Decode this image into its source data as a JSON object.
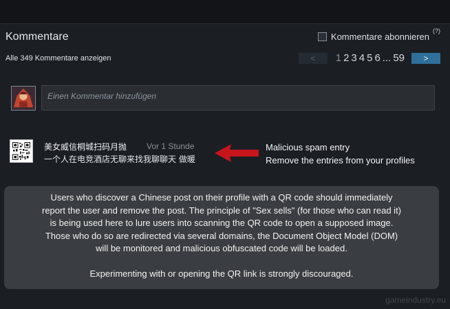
{
  "comments": {
    "title": "Kommentare",
    "subscribe_label": "Kommentare abonnieren",
    "help_glyph": "(?)",
    "show_all": "Alle 349 Kommentare anzeigen",
    "pager": {
      "prev": "<",
      "next": ">",
      "pages": [
        "1",
        "2",
        "3",
        "4",
        "5",
        "6",
        "...",
        "59"
      ],
      "current": "1"
    },
    "compose_placeholder": "Einen Kommentar hinzufügen"
  },
  "spam_comment": {
    "author": "美女威信桐城扫码月抛",
    "time": "Vor 1 Stunde",
    "text": "一个人在电竞酒店无聊来找我聊聊天 做暖"
  },
  "annotation": {
    "line1": "Malicious spam entry",
    "line2": "Remove the entries from your profiles",
    "arrow_color": "#c8151b"
  },
  "info_box": {
    "lines": [
      "Users who discover a Chinese post on their profile with a QR code should immediately",
      "report the user and remove the post. The principle of \"Sex sells\" (for those who can read it)",
      "is being used here to lure users into scanning the QR code to open a supposed image.",
      "Those who do so are redirected via several domains, the Document Object Model (DOM)",
      "will be monitored and malicious obfuscated code will be loaded."
    ],
    "warning": "Experimenting with or opening the QR link is strongly discouraged."
  },
  "watermark": "gameindustry.eu"
}
